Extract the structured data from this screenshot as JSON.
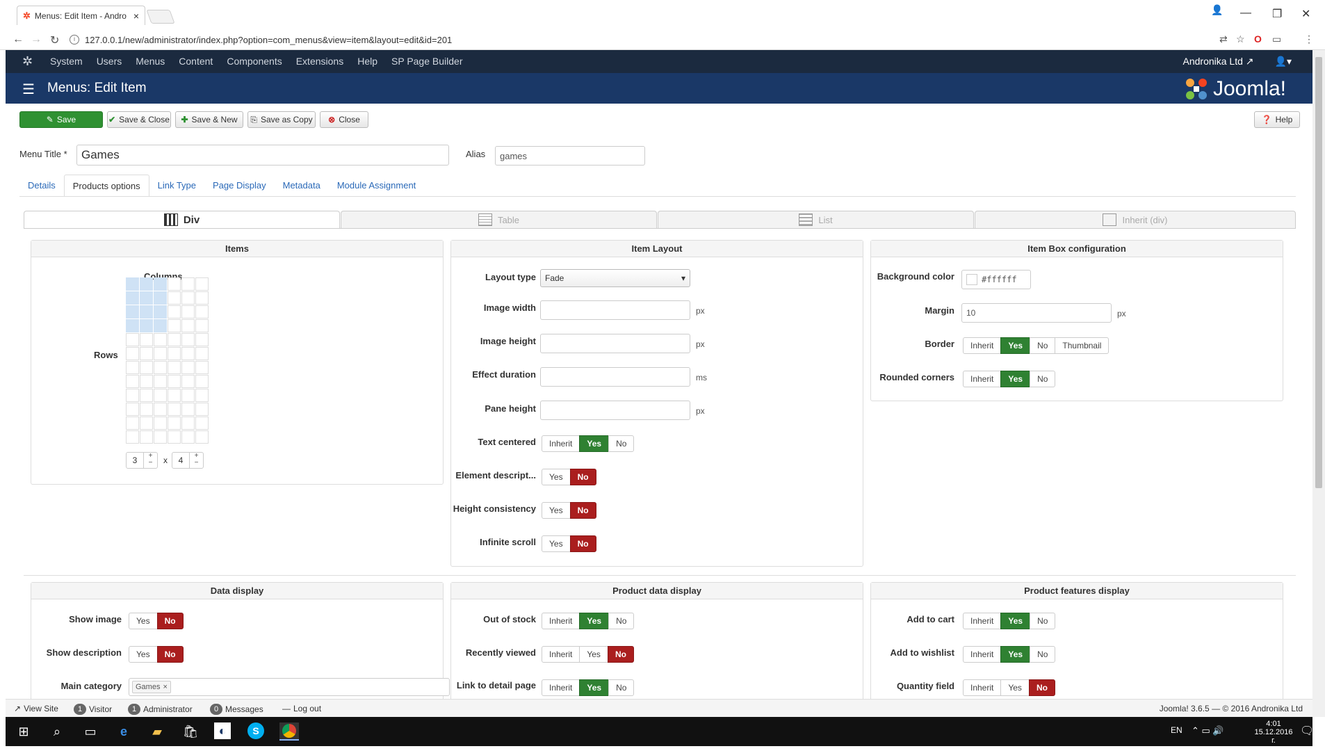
{
  "browser": {
    "tab_title": "Menus: Edit Item - Andro",
    "url": "127.0.0.1/new/administrator/index.php?option=com_menus&view=item&layout=edit&id=201"
  },
  "topnav": {
    "items": [
      "System",
      "Users",
      "Menus",
      "Content",
      "Components",
      "Extensions",
      "Help",
      "SP Page Builder"
    ],
    "site_name": "Andronika Ltd"
  },
  "header": {
    "title": "Menus: Edit Item",
    "logo": "Joomla!"
  },
  "toolbar": {
    "save": "Save",
    "save_close": "Save & Close",
    "save_new": "Save & New",
    "save_copy": "Save as Copy",
    "close": "Close",
    "help": "Help"
  },
  "form": {
    "menu_title_label": "Menu Title *",
    "menu_title_value": "Games",
    "alias_label": "Alias",
    "alias_value": "games"
  },
  "tabs": [
    "Details",
    "Products options",
    "Link Type",
    "Page Display",
    "Metadata",
    "Module Assignment"
  ],
  "layout_tabs": [
    "Div",
    "Table",
    "List",
    "Inherit (div)"
  ],
  "items_panel": {
    "title": "Items",
    "columns_label": "Columns",
    "rows_label": "Rows",
    "cols_value": "3",
    "x": "x",
    "rows_value": "4"
  },
  "layout_panel": {
    "title": "Item Layout",
    "layout_type_label": "Layout type",
    "layout_type_value": "Fade",
    "image_width_label": "Image width",
    "image_height_label": "Image height",
    "effect_duration_label": "Effect duration",
    "pane_height_label": "Pane height",
    "text_centered_label": "Text centered",
    "element_desc_label": "Element descript...",
    "height_consistency_label": "Height consistency",
    "infinite_scroll_label": "Infinite scroll",
    "px": "px",
    "ms": "ms"
  },
  "box_panel": {
    "title": "Item Box configuration",
    "bg_color_label": "Background color",
    "bg_color_value": "#ffffff",
    "margin_label": "Margin",
    "margin_value": "10",
    "border_label": "Border",
    "rounded_label": "Rounded corners",
    "px": "px"
  },
  "data_display": {
    "title": "Data display",
    "show_image_label": "Show image",
    "show_desc_label": "Show description",
    "main_category_label": "Main category",
    "main_category_tag": "Games"
  },
  "product_data": {
    "title": "Product data display",
    "out_of_stock_label": "Out of stock",
    "recently_viewed_label": "Recently viewed",
    "link_detail_label": "Link to detail page"
  },
  "product_features": {
    "title": "Product features display",
    "add_cart_label": "Add to cart",
    "add_wishlist_label": "Add to wishlist",
    "quantity_label": "Quantity field"
  },
  "options": {
    "inherit": "Inherit",
    "yes": "Yes",
    "no": "No",
    "thumbnail": "Thumbnail"
  },
  "statusbar": {
    "view_site": "View Site",
    "visitor_count": "1",
    "visitor": "Visitor",
    "admin_count": "1",
    "admin": "Administrator",
    "messages_count": "0",
    "messages": "Messages",
    "logout": "Log out",
    "version": "Joomla! 3.6.5 — © 2016 Andronika Ltd"
  },
  "taskbar": {
    "lang": "EN",
    "time": "4:01",
    "date": "15.12.2016 г."
  }
}
